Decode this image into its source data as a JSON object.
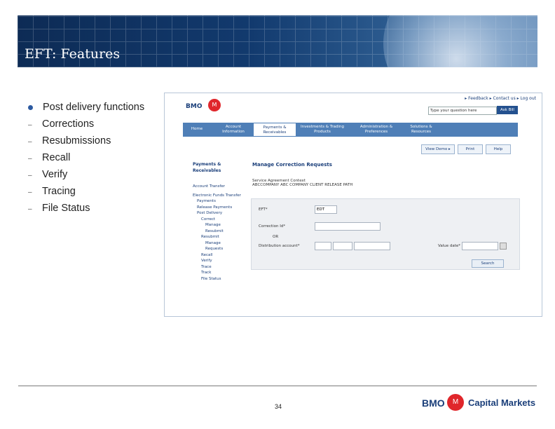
{
  "slide": {
    "title": "EFT: Features",
    "main_bullet": "Post delivery functions",
    "sub_bullets": [
      "Corrections",
      "Resubmissions",
      "Recall",
      "Verify",
      "Tracing",
      "File Status"
    ],
    "page_number": "34"
  },
  "footer_logo": {
    "bmo": "BMO",
    "name": "Capital Markets"
  },
  "screenshot": {
    "logo": "BMO",
    "top_links": "▸ Feedback  ▸ Contact us  ▸ Log out",
    "search_placeholder": "Type your question here",
    "ask_button": "Ask Bill",
    "nav_tabs": [
      {
        "label": "Home"
      },
      {
        "label": "Account Information"
      },
      {
        "label": "Payments & Receivables"
      },
      {
        "label": "Investments & Trading Products"
      },
      {
        "label": "Administration & Preferences"
      },
      {
        "label": "Solutions & Resources"
      }
    ],
    "tools": [
      "View Demo ▸",
      "Print",
      "Help"
    ],
    "left_nav": {
      "heading": "Payments & Receivables",
      "items": [
        "Account Transfer",
        "Electronic Funds Transfer",
        "Payments",
        "Release Payments",
        "Post Delivery",
        "Correct",
        "Manage",
        "Resubmit",
        "Resubmit",
        "Manage",
        "Requests",
        "Recall",
        "Verify",
        "Trace",
        "Track",
        "File Status"
      ]
    },
    "form": {
      "title": "Manage Correction Requests",
      "subtitle": "Service Agreement Context",
      "context": "ABCCOMPANY ABC COMPANY CLIENT RELEASE PATH",
      "field_1": "EFT*",
      "field_1_value": "EDT",
      "field_2": "Correction Id*",
      "or_label": "OR",
      "field_3": "Distribution account*",
      "field_4": "Value date*",
      "search_button": "Search"
    }
  }
}
